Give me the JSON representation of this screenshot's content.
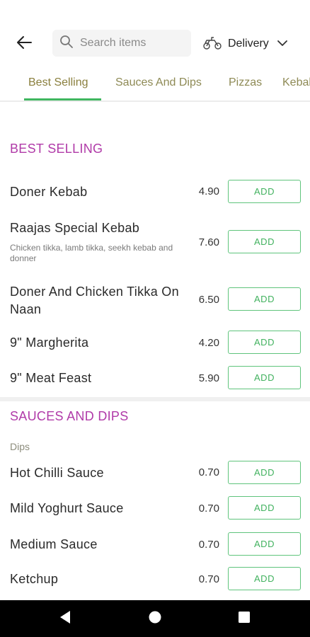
{
  "header": {
    "search_placeholder": "Search items",
    "delivery_label": "Delivery"
  },
  "tabs": [
    {
      "label": "Best Selling",
      "active": true
    },
    {
      "label": "Sauces And Dips",
      "active": false
    },
    {
      "label": "Pizzas",
      "active": false
    },
    {
      "label": "Kebabs",
      "active": false
    }
  ],
  "sections": {
    "best_selling": {
      "title": "BEST SELLING",
      "items": [
        {
          "name": "Doner Kebab",
          "price": "4.90",
          "add_label": "ADD"
        },
        {
          "name": "Raajas Special Kebab",
          "description": "Chicken tikka, lamb tikka, seekh kebab and donner",
          "price": "7.60",
          "add_label": "ADD"
        },
        {
          "name": "Doner And Chicken Tikka On Naan",
          "price": "6.50",
          "add_label": "ADD"
        },
        {
          "name": "9\" Margherita",
          "price": "4.20",
          "add_label": "ADD"
        },
        {
          "name": "9\" Meat Feast",
          "price": "5.90",
          "add_label": "ADD"
        }
      ]
    },
    "sauces_and_dips": {
      "title": "SAUCES AND DIPS",
      "subtitle": "Dips",
      "items": [
        {
          "name": "Hot Chilli Sauce",
          "price": "0.70",
          "add_label": "ADD"
        },
        {
          "name": "Mild Yoghurt Sauce",
          "price": "0.70",
          "add_label": "ADD"
        },
        {
          "name": "Medium Sauce",
          "price": "0.70",
          "add_label": "ADD"
        },
        {
          "name": "Ketchup",
          "price": "0.70",
          "add_label": "ADD"
        }
      ]
    }
  },
  "colors": {
    "section_title": "#b03aa8",
    "accent_green": "#3fb65f",
    "tab_text": "#8e8a55"
  },
  "icons": {
    "back": "arrow-left-icon",
    "search": "search-icon",
    "delivery": "scooter-icon",
    "dropdown": "chevron-down-icon",
    "nav_back": "triangle-back-icon",
    "nav_home": "circle-home-icon",
    "nav_recent": "square-recent-icon"
  }
}
